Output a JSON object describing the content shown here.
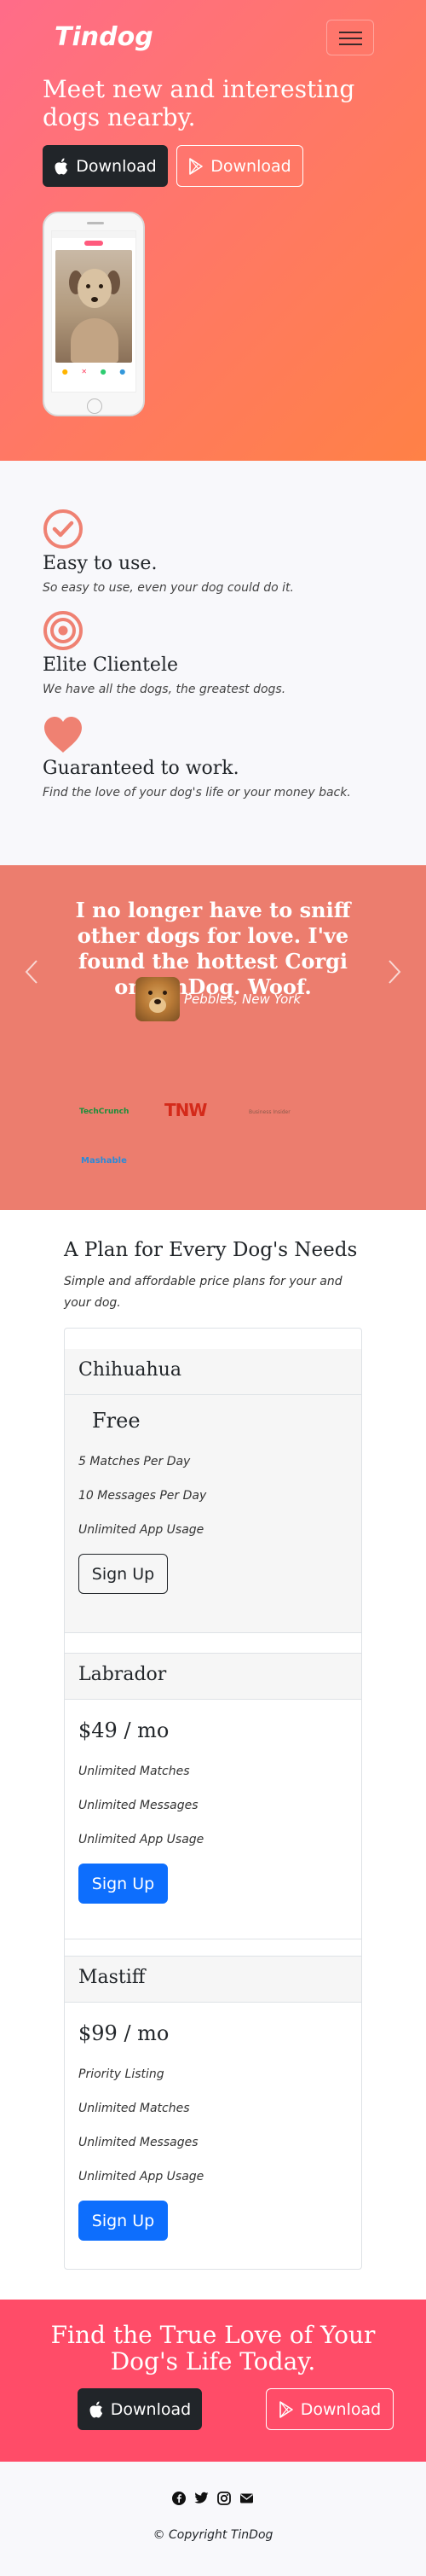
{
  "nav": {
    "brand": "Tindog"
  },
  "hero": {
    "title": "Meet new and interesting dogs nearby.",
    "download_apple": "Download",
    "download_google": "Download"
  },
  "features": [
    {
      "icon": "check-circle-icon",
      "title": "Easy to use.",
      "text": "So easy to use, even your dog could do it."
    },
    {
      "icon": "bullseye-icon",
      "title": "Elite Clientele",
      "text": "We have all the dogs, the greatest dogs."
    },
    {
      "icon": "heart-icon",
      "title": "Guaranteed to work.",
      "text": "Find the love of your dog's life or your money back."
    }
  ],
  "testimonial": {
    "quote": "I no longer have to sniff other dogs for love. I've found the hottest Corgi on TinDog. Woof.",
    "author": "Pebbles, New York"
  },
  "press": [
    "TechCrunch",
    "TNW",
    "Business Insider",
    "Mashable"
  ],
  "pricing": {
    "title": "A Plan for Every Dog's Needs",
    "subtitle": "Simple and affordable price plans for your and your dog.",
    "plans": [
      {
        "name": "Chihuahua",
        "price": "Free",
        "features": [
          "5 Matches Per Day",
          "10 Messages Per Day",
          "Unlimited App Usage"
        ],
        "button": "Sign Up"
      },
      {
        "name": "Labrador",
        "price": "$49 / mo",
        "features": [
          "Unlimited Matches",
          "Unlimited Messages",
          "Unlimited App Usage"
        ],
        "button": "Sign Up"
      },
      {
        "name": "Mastiff",
        "price": "$99 / mo",
        "features": [
          "Priority Listing",
          "Unlimited Matches",
          "Unlimited Messages",
          "Unlimited App Usage"
        ],
        "button": "Sign Up"
      }
    ]
  },
  "cta": {
    "title": "Find the True Love of Your Dog's Life Today.",
    "download_apple": "Download",
    "download_google": "Download"
  },
  "footer": {
    "social": [
      "facebook-icon",
      "twitter-icon",
      "instagram-icon",
      "envelope-icon"
    ],
    "copyright": "© Copyright TinDog"
  },
  "colors": {
    "hero_from": "#ff6c89",
    "hero_to": "#ff8146",
    "accent": "#ef8172",
    "testimonial_bg": "#ec7d6e",
    "cta_bg": "#ff4c68",
    "primary": "#0d6efd"
  }
}
